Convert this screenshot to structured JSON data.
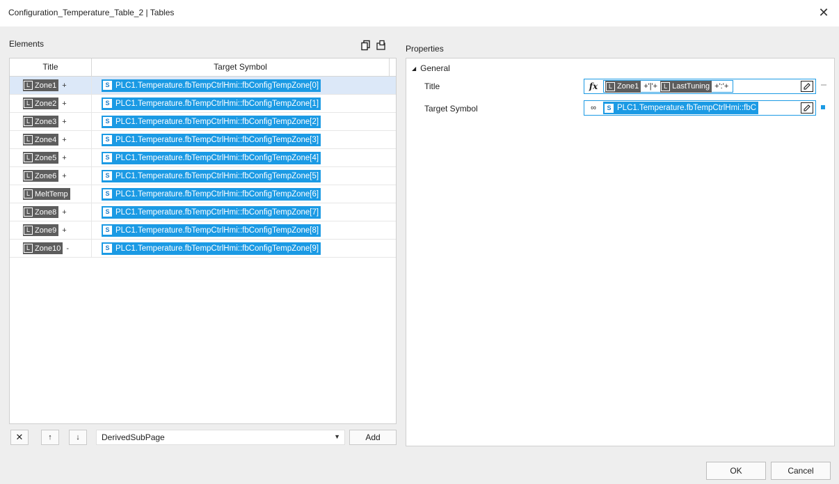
{
  "window": {
    "title": "Configuration_Temperature_Table_2 | Tables",
    "close_icon": "close-icon"
  },
  "elements": {
    "label": "Elements",
    "icons": [
      "copy-icon",
      "paste-icon"
    ],
    "columns": [
      "Title",
      "Target Symbol"
    ],
    "rows": [
      {
        "title": "Zone1",
        "title_suffix": "+",
        "target": "PLC1.Temperature.fbTempCtrlHmi::fbConfigTempZone[0]",
        "selected": true
      },
      {
        "title": "Zone2",
        "title_suffix": "+",
        "target": "PLC1.Temperature.fbTempCtrlHmi::fbConfigTempZone[1]"
      },
      {
        "title": "Zone3",
        "title_suffix": "+",
        "target": "PLC1.Temperature.fbTempCtrlHmi::fbConfigTempZone[2]"
      },
      {
        "title": "Zone4",
        "title_suffix": "+",
        "target": "PLC1.Temperature.fbTempCtrlHmi::fbConfigTempZone[3]"
      },
      {
        "title": "Zone5",
        "title_suffix": "+",
        "target": "PLC1.Temperature.fbTempCtrlHmi::fbConfigTempZone[4]"
      },
      {
        "title": "Zone6",
        "title_suffix": "+",
        "target": "PLC1.Temperature.fbTempCtrlHmi::fbConfigTempZone[5]"
      },
      {
        "title": "MeltTemp",
        "title_suffix": "",
        "target": "PLC1.Temperature.fbTempCtrlHmi::fbConfigTempZone[6]"
      },
      {
        "title": "Zone8",
        "title_suffix": "+",
        "target": "PLC1.Temperature.fbTempCtrlHmi::fbConfigTempZone[7]"
      },
      {
        "title": "Zone9",
        "title_suffix": "+",
        "target": "PLC1.Temperature.fbTempCtrlHmi::fbConfigTempZone[8]"
      },
      {
        "title": "Zone10",
        "title_suffix": "-",
        "target": "PLC1.Temperature.fbTempCtrlHmi::fbConfigTempZone[9]"
      }
    ],
    "chip_badges": {
      "local": "L",
      "symbol": "S"
    }
  },
  "toolbar": {
    "delete_icon": "delete-icon",
    "up_icon": "arrow-up-icon",
    "down_icon": "arrow-down-icon",
    "type_select_value": "DerivedSubPage",
    "add_label": "Add"
  },
  "properties": {
    "label": "Properties",
    "group": "General",
    "title_label": "Title",
    "title_expr": {
      "chip1": "Zone1",
      "op1": "+'|'+",
      "chip2": "LastTuning",
      "op2": "+':'+"
    },
    "target_label": "Target Symbol",
    "target_value": "PLC1.Temperature.fbTempCtrlHmi::fbC"
  },
  "footer": {
    "ok_label": "OK",
    "cancel_label": "Cancel"
  },
  "colors": {
    "accent": "#1b9ae4",
    "chip_dark": "#5d5d5d",
    "selection": "#dce8f8"
  }
}
